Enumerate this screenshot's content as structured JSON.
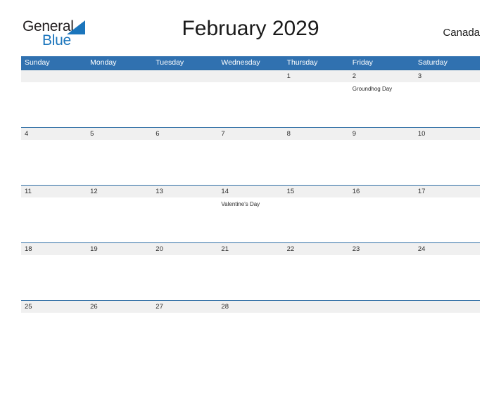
{
  "brand": {
    "name_part1": "General",
    "name_part2": "Blue",
    "triangle_color": "#1b75bc",
    "text_color": "#231f20"
  },
  "header": {
    "title": "February 2029",
    "country": "Canada"
  },
  "theme": {
    "header_blue": "#3071b0",
    "row_divider_blue": "#2e6da4",
    "date_strip_gray": "#f0f0f0",
    "text_dark": "#2b2b2b"
  },
  "calendar": {
    "weekdays": [
      "Sunday",
      "Monday",
      "Tuesday",
      "Wednesday",
      "Thursday",
      "Friday",
      "Saturday"
    ],
    "weeks": [
      {
        "dates": [
          "",
          "",
          "",
          "",
          "1",
          "2",
          "3"
        ],
        "events": [
          "",
          "",
          "",
          "",
          "",
          "Groundhog Day",
          ""
        ]
      },
      {
        "dates": [
          "4",
          "5",
          "6",
          "7",
          "8",
          "9",
          "10"
        ],
        "events": [
          "",
          "",
          "",
          "",
          "",
          "",
          ""
        ]
      },
      {
        "dates": [
          "11",
          "12",
          "13",
          "14",
          "15",
          "16",
          "17"
        ],
        "events": [
          "",
          "",
          "",
          "Valentine's Day",
          "",
          "",
          ""
        ]
      },
      {
        "dates": [
          "18",
          "19",
          "20",
          "21",
          "22",
          "23",
          "24"
        ],
        "events": [
          "",
          "",
          "",
          "",
          "",
          "",
          ""
        ]
      },
      {
        "dates": [
          "25",
          "26",
          "27",
          "28",
          "",
          "",
          ""
        ],
        "events": [
          "",
          "",
          "",
          "",
          "",
          "",
          ""
        ]
      }
    ]
  }
}
